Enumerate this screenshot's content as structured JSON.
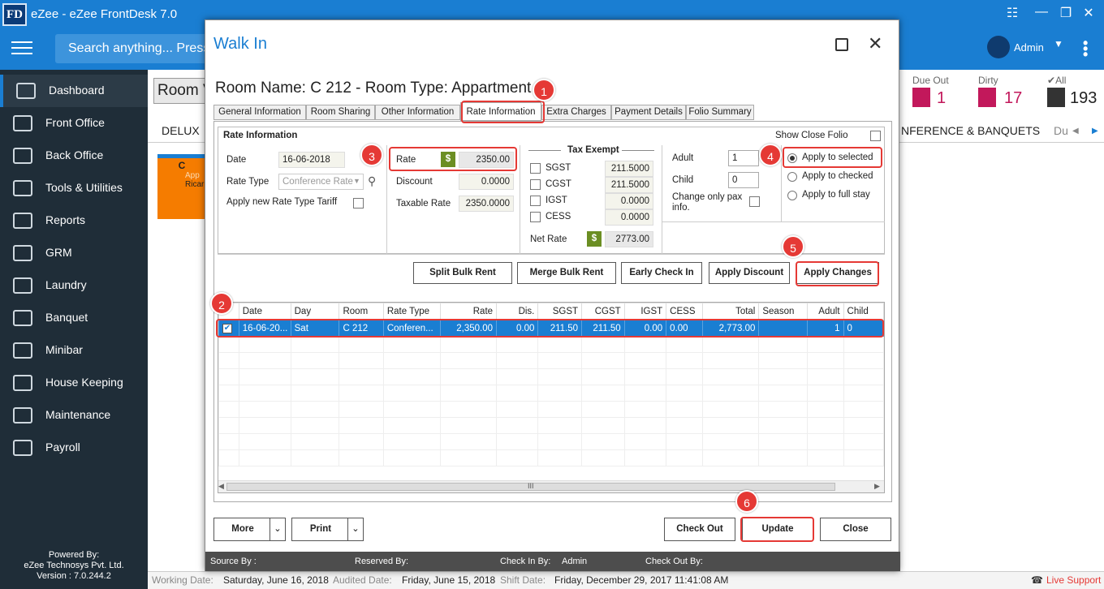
{
  "app": {
    "logo": "FD",
    "title": "eZee - eZee FrontDesk 7.0"
  },
  "header": {
    "search_placeholder": "Search anything... Press",
    "user": "Admin"
  },
  "sidebar": {
    "items": [
      {
        "label": "Dashboard",
        "icon": "dashboard-icon"
      },
      {
        "label": "Front Office",
        "icon": "front-office-icon"
      },
      {
        "label": "Back Office",
        "icon": "back-office-icon"
      },
      {
        "label": "Tools & Utilities",
        "icon": "tools-icon"
      },
      {
        "label": "Reports",
        "icon": "reports-icon"
      },
      {
        "label": "GRM",
        "icon": "grm-icon"
      },
      {
        "label": "Laundry",
        "icon": "laundry-icon"
      },
      {
        "label": "Banquet",
        "icon": "banquet-icon"
      },
      {
        "label": "Minibar",
        "icon": "minibar-icon"
      },
      {
        "label": "House Keeping",
        "icon": "housekeeping-icon"
      },
      {
        "label": "Maintenance",
        "icon": "maintenance-icon"
      },
      {
        "label": "Payroll",
        "icon": "payroll-icon"
      }
    ],
    "powered_by": "Powered By:",
    "company": "eZee Technosys Pvt. Ltd.",
    "version": "Version : 7.0.244.2"
  },
  "background": {
    "room_view_label": "Room V",
    "due_out_label": "Due Out",
    "due_out_count": "1",
    "dirty_label": "Dirty",
    "dirty_count": "17",
    "all_label": "All",
    "all_count": "193",
    "tab_delux": "DELUX",
    "tab_conference": "NFERENCE & BANQUETS",
    "tab_du": "Du",
    "card_letter": "C",
    "card_line1": "App",
    "card_line2": "Ricar"
  },
  "status_bar": {
    "working_date_label": "Working Date:",
    "working_date": "Saturday, June 16, 2018",
    "audited_date_label": "Audited Date:",
    "audited_date": "Friday, June 15, 2018",
    "shift_date_label": "Shift Date:",
    "shift_date": "Friday, December 29, 2017 11:41:08 AM",
    "live_support": "Live Support"
  },
  "dialog": {
    "title": "Walk In",
    "room_name": "Room Name: C 212 - Room Type: Appartment",
    "tabs": [
      "General Information",
      "Room Sharing",
      "Other Information",
      "Rate Information",
      "Extra Charges",
      "Payment Details",
      "Folio Summary"
    ],
    "rate_info_header": "Rate Information",
    "show_close_folio": "Show Close Folio",
    "date_label": "Date",
    "date_value": "16-06-2018",
    "rate_type_label": "Rate Type",
    "rate_type_value": "Conference Rate",
    "apply_new_tariff": "Apply new Rate Type Tariff",
    "rate_label": "Rate",
    "rate_value": "2350.00",
    "discount_label": "Discount",
    "discount_value": "0.0000",
    "taxable_rate_label": "Taxable Rate",
    "taxable_rate_value": "2350.0000",
    "tax_exempt_label": "Tax Exempt",
    "taxes": [
      {
        "name": "SGST",
        "value": "211.5000"
      },
      {
        "name": "CGST",
        "value": "211.5000"
      },
      {
        "name": "IGST",
        "value": "0.0000"
      },
      {
        "name": "CESS",
        "value": "0.0000"
      }
    ],
    "net_rate_label": "Net Rate",
    "net_rate_value": "2773.00",
    "adult_label": "Adult",
    "adult_value": "1",
    "child_label": "Child",
    "child_value": "0",
    "change_pax_label": "Change only pax info.",
    "apply_selected": "Apply to selected",
    "apply_checked": "Apply to checked",
    "apply_full_stay": "Apply to full stay",
    "buttons": {
      "split": "Split Bulk Rent",
      "merge": "Merge Bulk Rent",
      "early": "Early Check In",
      "discount": "Apply Discount",
      "apply_changes": "Apply Changes"
    },
    "grid": {
      "columns": [
        "Date",
        "Day",
        "Room",
        "Rate Type",
        "Rate",
        "Dis.",
        "SGST",
        "CGST",
        "IGST",
        "CESS",
        "Total",
        "Season",
        "Adult",
        "Child"
      ],
      "rows": [
        [
          "16-06-20...",
          "Sat",
          "C 212",
          "Conferen...",
          "2,350.00",
          "0.00",
          "211.50",
          "211.50",
          "0.00",
          "0.00",
          "2,773.00",
          "",
          "1",
          "0"
        ]
      ],
      "scroll_grip": "III"
    },
    "bottom": {
      "more": "More",
      "print": "Print",
      "check_out": "Check Out",
      "update": "Update",
      "close": "Close"
    },
    "footer": {
      "source_by": "Source By :",
      "reserved_by": "Reserved By:",
      "check_in_by": "Check In By:",
      "check_in_user": "Admin",
      "check_out_by": "Check Out By:"
    },
    "markers": [
      "1",
      "2",
      "3",
      "4",
      "5",
      "6"
    ]
  }
}
